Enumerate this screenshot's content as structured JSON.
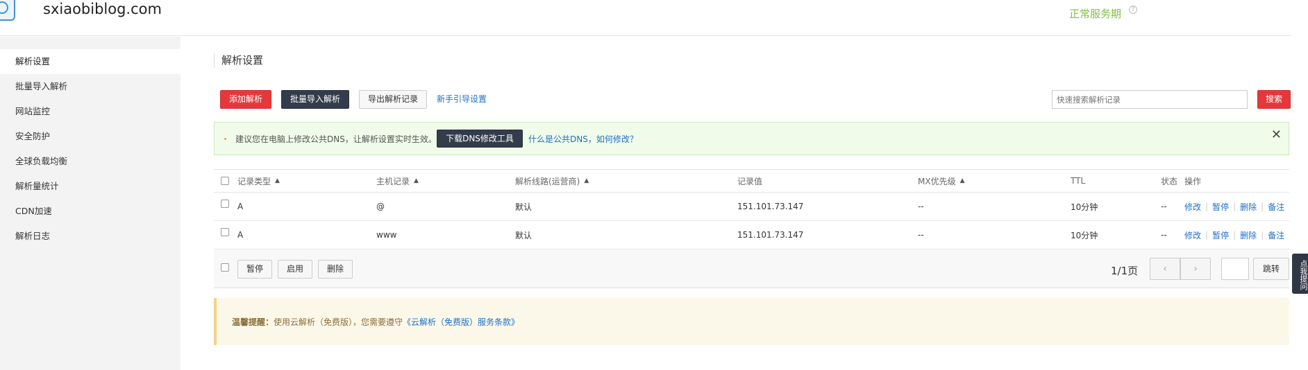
{
  "header": {
    "domain": "sxiaobiblog.com",
    "service_status": "正常服务期",
    "help_glyph": "?"
  },
  "sidebar": {
    "items": [
      {
        "label": "解析设置"
      },
      {
        "label": "批量导入解析"
      },
      {
        "label": "网站监控"
      },
      {
        "label": "安全防护"
      },
      {
        "label": "全球负载均衡"
      },
      {
        "label": "解析量统计"
      },
      {
        "label": "CDN加速"
      },
      {
        "label": "解析日志"
      }
    ]
  },
  "main": {
    "title": "解析设置",
    "toolbar": {
      "add_label": "添加解析",
      "batch_import_label": "批量导入解析",
      "export_label": "导出解析记录",
      "guide_link": "新手引导设置",
      "search_placeholder": "快速搜索解析记录",
      "search_label": "搜索"
    },
    "notice": {
      "text": "建议您在电脑上修改公共DNS，让解析设置实时生效。",
      "download_label": "下载DNS修改工具",
      "link": "什么是公共DNS，如何修改？",
      "close_glyph": "✕"
    },
    "table": {
      "headers": {
        "type": "记录类型",
        "host": "主机记录",
        "line": "解析线路(运营商)",
        "value": "记录值",
        "mx": "MX优先级",
        "ttl": "TTL",
        "status": "状态",
        "ops": "操作"
      },
      "rows": [
        {
          "type": "A",
          "host": "@",
          "line": "默认",
          "value": "151.101.73.147",
          "mx": "--",
          "ttl": "10分钟",
          "status": "--"
        },
        {
          "type": "A",
          "host": "www",
          "line": "默认",
          "value": "151.101.73.147",
          "mx": "--",
          "ttl": "10分钟",
          "status": "--"
        }
      ],
      "ops": {
        "edit": "修改",
        "pause": "暂停",
        "delete": "删除",
        "note": "备注"
      },
      "footer": {
        "pause_label": "暂停",
        "enable_label": "启用",
        "delete_label": "删除",
        "page_info": "1/1页",
        "jump_label": "跳转"
      }
    },
    "tip": {
      "strong": "温馨提醒：",
      "text": "使用云解析（免费版），您需要遵守",
      "link": "《云解析（免费版）服务条款》"
    }
  },
  "side_tab": {
    "label": "点我提问"
  }
}
